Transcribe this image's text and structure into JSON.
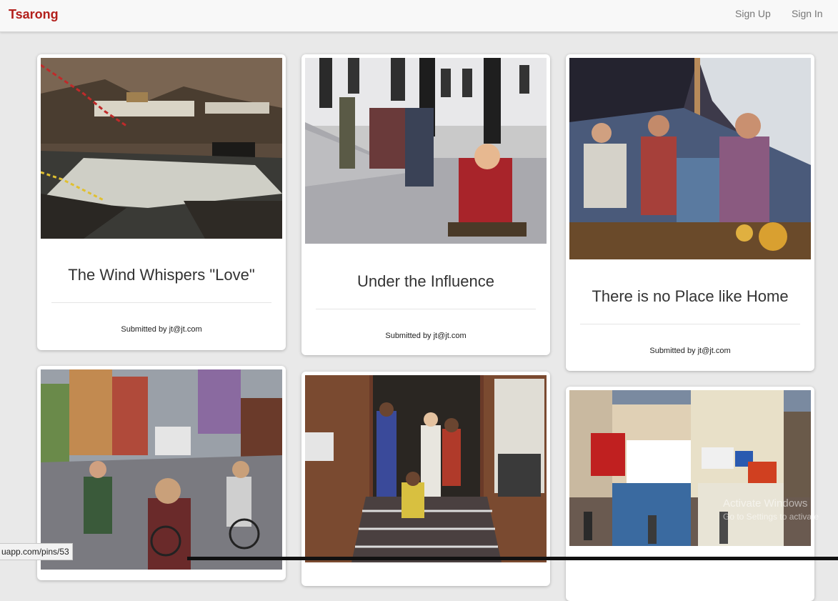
{
  "navbar": {
    "brand": "Tsarong",
    "signup_label": "Sign Up",
    "signin_label": "Sign In",
    "brand_color": "#b3201c"
  },
  "pins": [
    {
      "title": "The Wind Whispers \"Love\"",
      "submitted": "Submitted by jt@jt.com"
    },
    {
      "title": "Under the Influence",
      "submitted": "Submitted by jt@jt.com"
    },
    {
      "title": "There is no Place like Home",
      "submitted": "Submitted by jt@jt.com"
    },
    {
      "title": "",
      "submitted": ""
    },
    {
      "title": "",
      "submitted": ""
    },
    {
      "title": "",
      "submitted": ""
    }
  ],
  "status_bar": {
    "url": "uapp.com/pins/53"
  },
  "watermark": {
    "line1": "Activate Windows",
    "line2": "Go to Settings to activate"
  }
}
